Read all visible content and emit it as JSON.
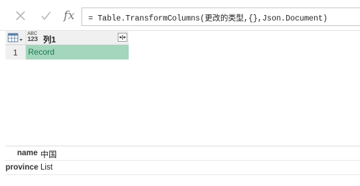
{
  "formula_bar": {
    "cancel_icon": "x-icon",
    "confirm_icon": "check-icon",
    "fx_label": "fx",
    "formula": "= Table.TransformColumns(更改的类型,{},Json.Document)"
  },
  "grid": {
    "column": {
      "type_label_top": "ABC",
      "type_label_bottom": "123",
      "name": "列1",
      "expand_icon": "expand-columns-icon"
    },
    "rows": [
      {
        "number": "1",
        "value": "Record"
      }
    ]
  },
  "details": [
    {
      "label": "name",
      "value": "中国"
    },
    {
      "label": "province",
      "value": "List"
    }
  ],
  "colors": {
    "record_cell_bg": "#a3d6bd",
    "record_text": "#1f7a4c",
    "header_bg": "#f0f0f0"
  }
}
